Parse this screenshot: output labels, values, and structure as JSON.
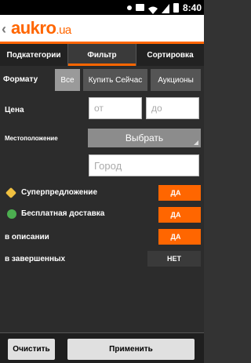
{
  "status": {
    "time": "8:40"
  },
  "app": {
    "back": "‹",
    "logo_main": "aukro",
    "logo_suffix": ".ua"
  },
  "tabs": [
    {
      "label": "Подкатегории"
    },
    {
      "label": "Фильтр"
    },
    {
      "label": "Сортировка"
    }
  ],
  "filter": {
    "format_label": "Формату",
    "format_options": [
      "Все",
      "Купить Сейчас",
      "Аукционы"
    ],
    "price_label": "Цена",
    "price_from_placeholder": "от",
    "price_to_placeholder": "до",
    "location_label": "Местоположение",
    "location_select": "Выбрать",
    "city_placeholder": "Город",
    "super_offer_label": "Суперпредложение",
    "super_offer_value": "ДА",
    "free_delivery_label": "Бесплатная доставка",
    "free_delivery_value": "ДА",
    "in_description_label": "в описании",
    "in_description_value": "ДА",
    "in_finished_label": "в завершенных",
    "in_finished_value": "НЕТ"
  },
  "bottom": {
    "clear": "Очистить",
    "apply": "Применить"
  },
  "colors": {
    "accent": "#ff6600"
  }
}
